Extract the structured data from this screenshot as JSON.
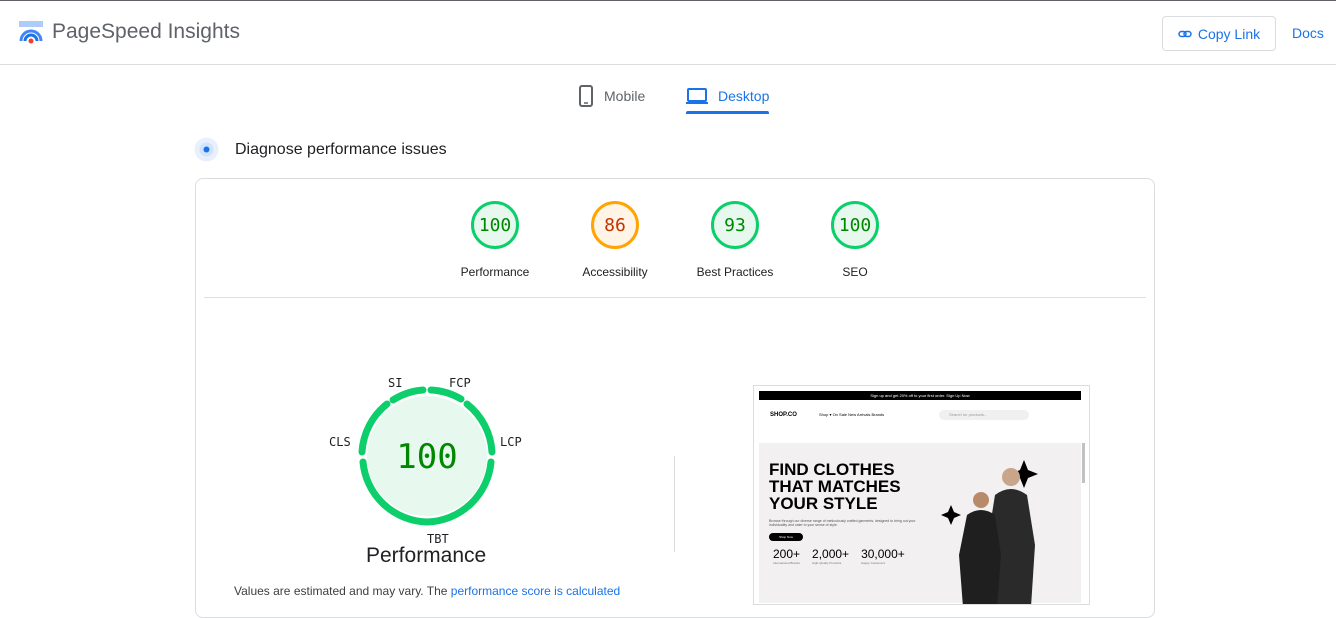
{
  "header": {
    "brand_title": "PageSpeed Insights",
    "copy_link_label": "Copy Link",
    "docs_label": "Docs"
  },
  "tabs": [
    {
      "label": "Mobile",
      "active": false
    },
    {
      "label": "Desktop",
      "active": true
    }
  ],
  "diagnose": {
    "title": "Diagnose performance issues"
  },
  "scores": [
    {
      "value": "100",
      "label": "Performance",
      "status": "pass"
    },
    {
      "value": "86",
      "label": "Accessibility",
      "status": "average"
    },
    {
      "value": "93",
      "label": "Best Practices",
      "status": "pass"
    },
    {
      "value": "100",
      "label": "SEO",
      "status": "pass"
    }
  ],
  "performance": {
    "score": "100",
    "title": "Performance",
    "metrics": {
      "si": "SI",
      "fcp": "FCP",
      "lcp": "LCP",
      "tbt": "TBT",
      "cls": "CLS"
    },
    "note_prefix": "Values are estimated and may vary. The ",
    "note_link": "performance score is calculated"
  },
  "screenshot": {
    "banner": "Sign up and get 20% off to your first order.  Sign Up Now",
    "logo": "SHOP.CO",
    "menu": "Shop ▾   On Sale   New Arrivals   Brands",
    "search_placeholder": "Search for products...",
    "headline": "FIND CLOTHES THAT MATCHES YOUR STYLE",
    "description": "Browse through our diverse range of meticulously crafted garments, designed to bring out your individuality and cater to your sense of style.",
    "button": "Shop Now",
    "stats": [
      {
        "value": "200+",
        "label": "International Brands"
      },
      {
        "value": "2,000+",
        "label": "High-Quality Products"
      },
      {
        "value": "30,000+",
        "label": "Happy Customers"
      }
    ]
  },
  "colors": {
    "accent": "#1a73e8",
    "pass": "#0cce6b",
    "average": "#ffa400"
  }
}
